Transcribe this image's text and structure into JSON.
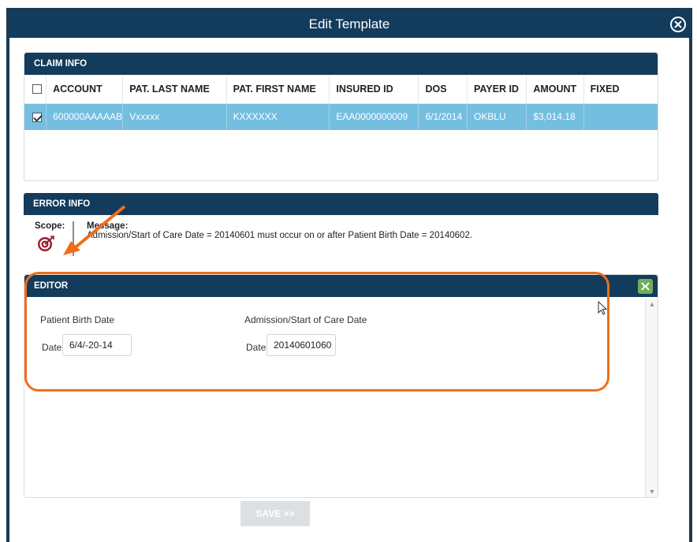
{
  "dialog": {
    "title": "Edit Template",
    "close_icon": "close-icon"
  },
  "claim_info": {
    "header": "CLAIM INFO",
    "columns": [
      "ACCOUNT",
      "PAT. LAST NAME",
      "PAT. FIRST NAME",
      "INSURED ID",
      "DOS",
      "PAYER ID",
      "AMOUNT",
      "FIXED"
    ],
    "rows": [
      {
        "checked": true,
        "account": "600000AAAAAB",
        "last_name": "Vxxxxx",
        "first_name": "KXXXXXX",
        "insured_id": "EAA0000000009",
        "dos": "6/1/2014",
        "payer_id": "OKBLU",
        "amount": "$3,014.18",
        "fixed": ""
      }
    ]
  },
  "error_info": {
    "header": "ERROR INFO",
    "scope_label": "Scope:",
    "scope_icon": "target-icon",
    "message_label": "Message:",
    "message_text": "Admission/Start of Care Date = 20140601 must occur on or after Patient Birth Date = 20140602."
  },
  "editor": {
    "header": "EDITOR",
    "action_icon": "merge-icon",
    "fields": [
      {
        "title": "Patient Birth Date",
        "label": "Date",
        "value": "6/4/-20-14"
      },
      {
        "title": "Admission/Start of Care Date",
        "label": "Date",
        "value": "20140601060"
      }
    ]
  },
  "save_button": "SAVE >>",
  "colors": {
    "header": "#133b5c",
    "selected_row": "#74bedf",
    "annotation": "#f06d1a",
    "action_button": "#6fae5a"
  }
}
